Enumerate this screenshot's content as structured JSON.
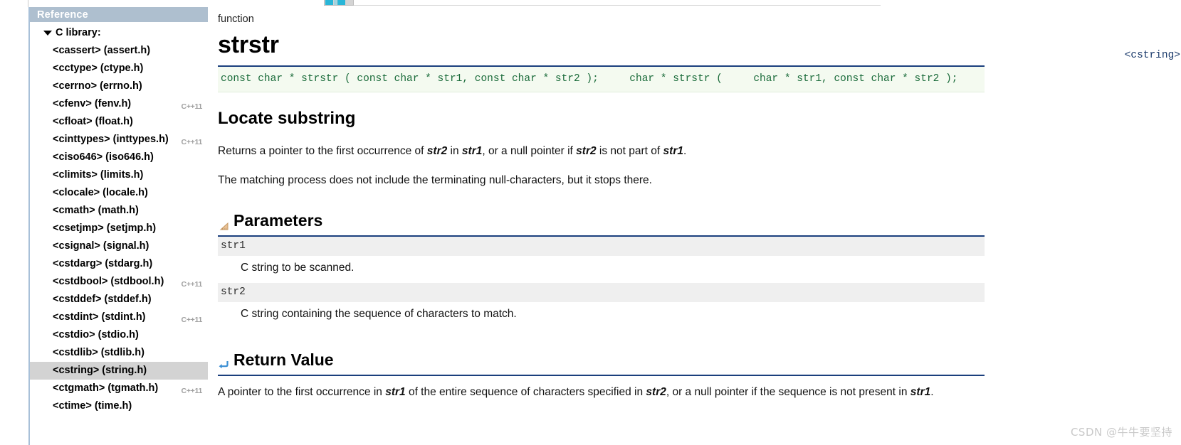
{
  "sidebar": {
    "title": "Reference",
    "root": {
      "label": "C library:",
      "expanded": true,
      "caret": "caret-down-icon"
    },
    "items": [
      {
        "label": "<cassert> (assert.h)",
        "tag": "",
        "selected": false
      },
      {
        "label": "<cctype> (ctype.h)",
        "tag": "",
        "selected": false
      },
      {
        "label": "<cerrno> (errno.h)",
        "tag": "",
        "selected": false
      },
      {
        "label": "<cfenv> (fenv.h)",
        "tag": "C++11",
        "selected": false
      },
      {
        "label": "<cfloat> (float.h)",
        "tag": "",
        "selected": false
      },
      {
        "label": "<cinttypes> (inttypes.h)",
        "tag": "C++11",
        "selected": false
      },
      {
        "label": "<ciso646> (iso646.h)",
        "tag": "",
        "selected": false
      },
      {
        "label": "<climits> (limits.h)",
        "tag": "",
        "selected": false
      },
      {
        "label": "<clocale> (locale.h)",
        "tag": "",
        "selected": false
      },
      {
        "label": "<cmath> (math.h)",
        "tag": "",
        "selected": false
      },
      {
        "label": "<csetjmp> (setjmp.h)",
        "tag": "",
        "selected": false
      },
      {
        "label": "<csignal> (signal.h)",
        "tag": "",
        "selected": false
      },
      {
        "label": "<cstdarg> (stdarg.h)",
        "tag": "",
        "selected": false
      },
      {
        "label": "<cstdbool> (stdbool.h)",
        "tag": "C++11",
        "selected": false
      },
      {
        "label": "<cstddef> (stddef.h)",
        "tag": "",
        "selected": false
      },
      {
        "label": "<cstdint> (stdint.h)",
        "tag": "C++11",
        "selected": false
      },
      {
        "label": "<cstdio> (stdio.h)",
        "tag": "",
        "selected": false
      },
      {
        "label": "<cstdlib> (stdlib.h)",
        "tag": "",
        "selected": false
      },
      {
        "label": "<cstring> (string.h)",
        "tag": "",
        "selected": true
      },
      {
        "label": "<ctgmath> (tgmath.h)",
        "tag": "C++11",
        "selected": false
      },
      {
        "label": "<ctime> (time.h)",
        "tag": "",
        "selected": false
      }
    ]
  },
  "article": {
    "kind": "function",
    "name": "strstr",
    "header_file": "<cstring>",
    "prototype": "const char * strstr ( const char * str1, const char * str2 );     char * strstr (     char * str1, const char * str2 );",
    "brief": "Locate substring",
    "paragraph_1_parts": [
      {
        "text": "Returns a pointer to the first occurrence of ",
        "em": false
      },
      {
        "text": "str2",
        "em": true
      },
      {
        "text": " in ",
        "em": false
      },
      {
        "text": "str1",
        "em": true
      },
      {
        "text": ", or a null pointer if ",
        "em": false
      },
      {
        "text": "str2",
        "em": true
      },
      {
        "text": " is not part of ",
        "em": false
      },
      {
        "text": "str1",
        "em": true
      },
      {
        "text": ".",
        "em": false
      }
    ],
    "paragraph_1_plain": "Returns a pointer to the first occurrence of str2 in str1, or a null pointer if str2 is not part of str1.",
    "paragraph_2": "The matching process does not include the terminating null-characters, but it stops there.",
    "parameters_heading": "Parameters",
    "parameters_icon": "ruler-triangle-icon",
    "parameters": [
      {
        "name": "str1",
        "description": "C string to be scanned."
      },
      {
        "name": "str2",
        "description": "C string containing the sequence of characters to match."
      }
    ],
    "return_heading": "Return Value",
    "return_icon": "return-arrow-icon",
    "return_plain": "A pointer to the first occurrence in str1 of the entire sequence of characters specified in str2, or a null pointer if the sequence is not present in str1."
  },
  "watermark": "CSDN @牛牛要坚持",
  "colors": {
    "sidebar_title_bg": "#aebfcf",
    "selected_row_bg": "#d3d3d3",
    "rule": "#1b3f7d",
    "code_text": "#1a6b3a",
    "code_bg": "#f4faf0",
    "param_bg": "#efefef",
    "header_file_text": "#1a3a6b",
    "cxx11_tag": "#a0a0a0",
    "watermark": "#c9c9c9"
  }
}
